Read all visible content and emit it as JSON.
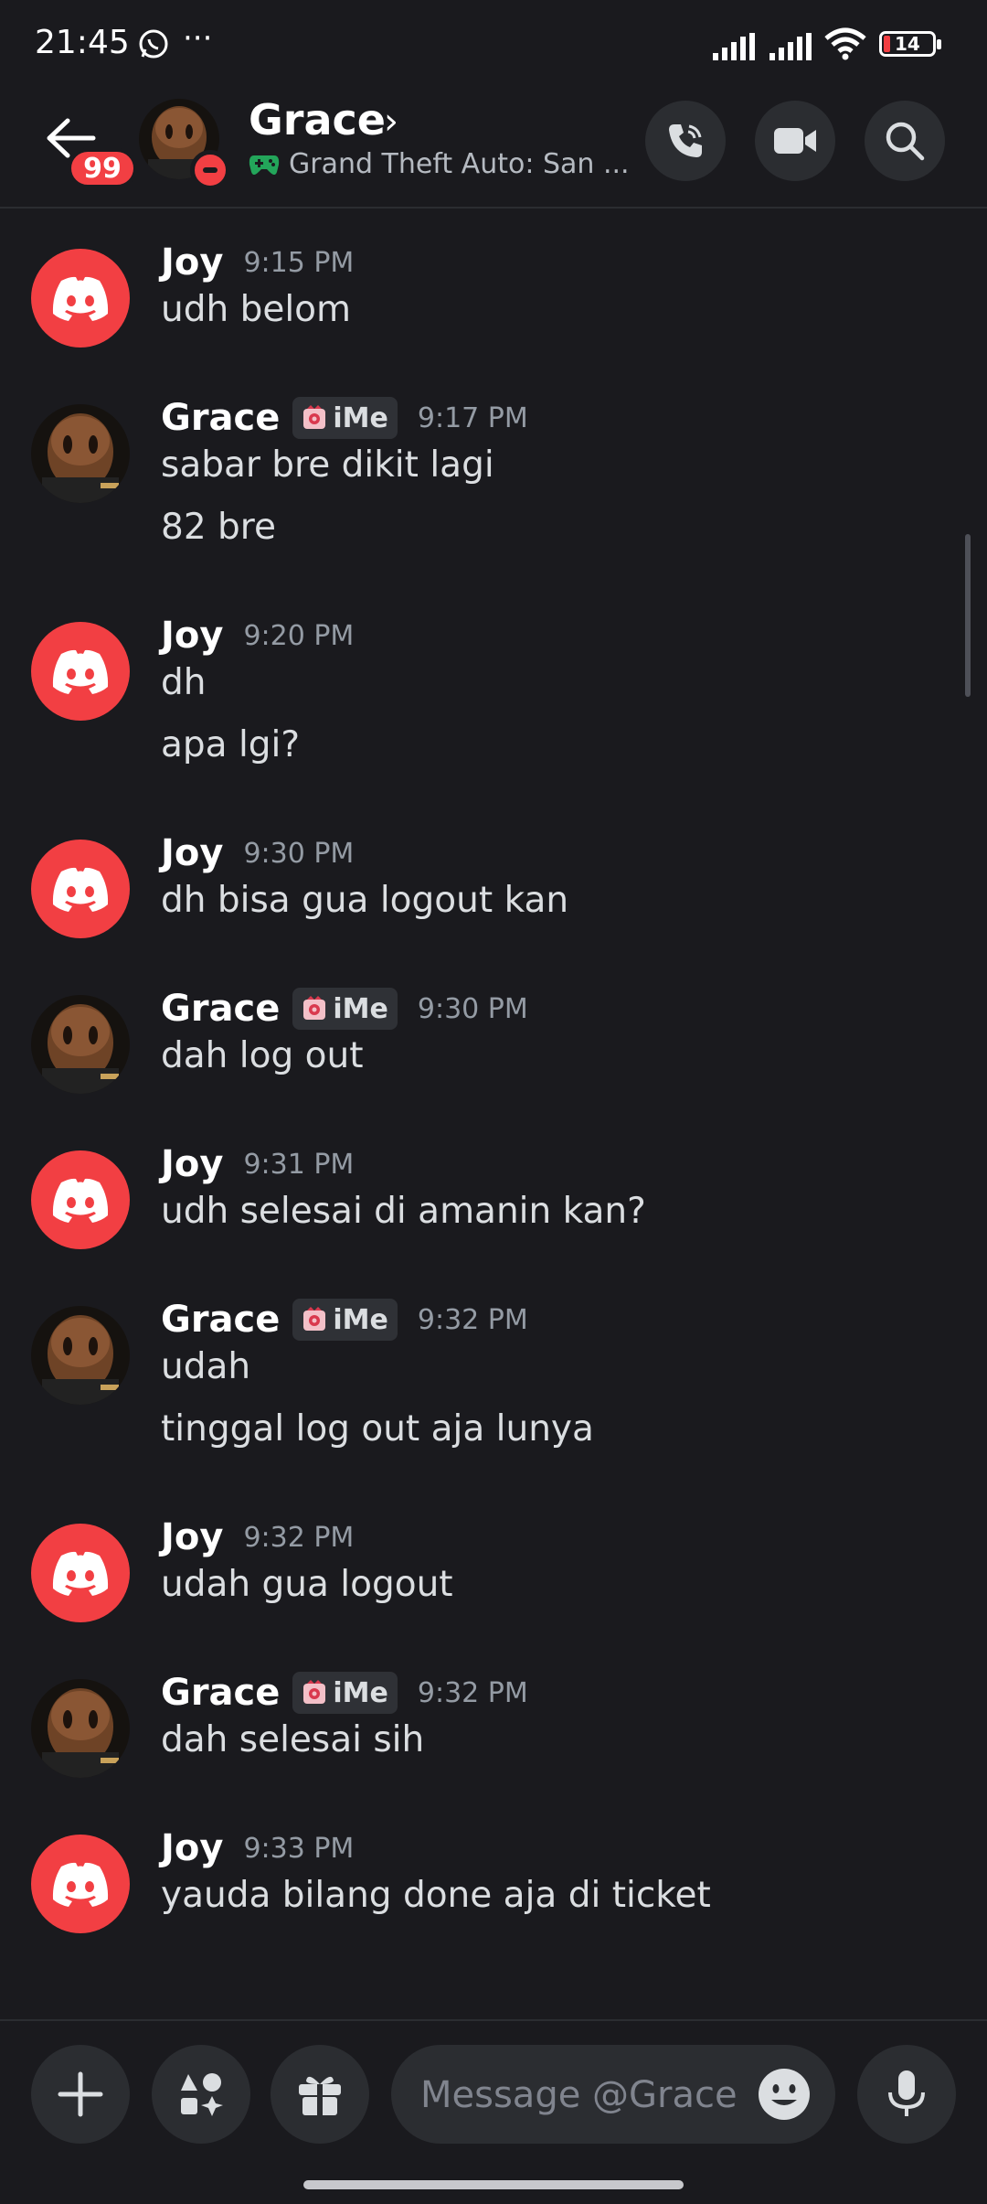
{
  "status_bar": {
    "time": "21:45",
    "more": "···",
    "battery": "14"
  },
  "header": {
    "back_badge": "99",
    "name": "Grace",
    "chevron": "›",
    "activity": "Grand Theft Auto: San ...",
    "icons": [
      "arrow-left-icon",
      "phone-call-icon",
      "video-camera-icon",
      "search-icon",
      "gamepad-icon"
    ]
  },
  "messages": [
    {
      "author": "Joy",
      "time": "9:15 PM",
      "lines": [
        "udh belom"
      ]
    },
    {
      "author": "Grace",
      "tag": "iMe",
      "time": "9:17 PM",
      "lines": [
        "sabar bre dikit lagi",
        "82 bre"
      ]
    },
    {
      "author": "Joy",
      "time": "9:20 PM",
      "lines": [
        "dh",
        "apa lgi?"
      ]
    },
    {
      "author": "Joy",
      "time": "9:30 PM",
      "lines": [
        "dh bisa gua logout kan"
      ]
    },
    {
      "author": "Grace",
      "tag": "iMe",
      "time": "9:30 PM",
      "lines": [
        "dah log out"
      ]
    },
    {
      "author": "Joy",
      "time": "9:31 PM",
      "lines": [
        "udh selesai di amanin kan?"
      ]
    },
    {
      "author": "Grace",
      "tag": "iMe",
      "time": "9:32 PM",
      "lines": [
        "udah",
        "tinggal log out aja lunya"
      ]
    },
    {
      "author": "Joy",
      "time": "9:32 PM",
      "lines": [
        "udah gua logout"
      ]
    },
    {
      "author": "Grace",
      "tag": "iMe",
      "time": "9:32 PM",
      "lines": [
        "dah selesai sih"
      ]
    },
    {
      "author": "Joy",
      "time": "9:33 PM",
      "lines": [
        "yauda bilang done aja di ticket"
      ]
    }
  ],
  "composer": {
    "placeholder": "Message @Grace",
    "icons": [
      "plus-icon",
      "apps-icon",
      "gift-icon",
      "emoji-icon",
      "microphone-icon"
    ]
  },
  "colors": {
    "background": "#1a1a1e",
    "discord_red": "#f23f43",
    "muted_text": "#949ba4"
  }
}
